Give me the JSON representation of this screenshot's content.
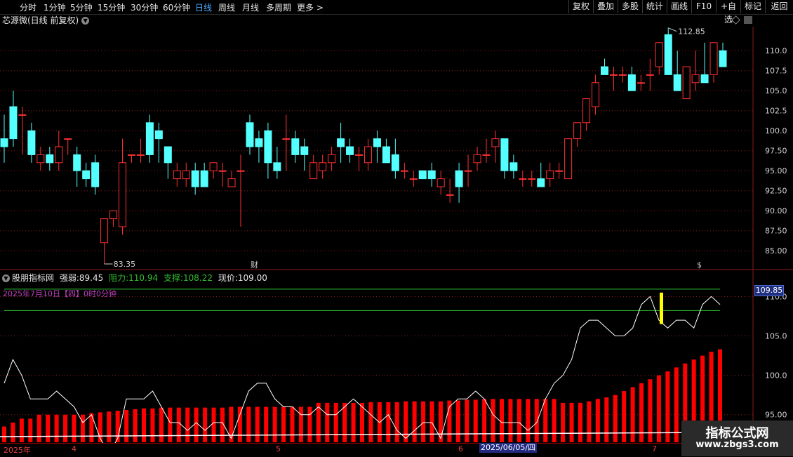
{
  "toolbar": {
    "periods": [
      "分时",
      "1分钟",
      "5分钟",
      "15分钟",
      "30分钟",
      "60分钟",
      "日线",
      "周线",
      "月线",
      "多周期",
      "更多 >"
    ],
    "active_period": "日线",
    "buttons": [
      "复权",
      "叠加",
      "多股",
      "统计",
      "画线",
      "F10",
      "+自选",
      "标记",
      "返回"
    ]
  },
  "stock": {
    "title": "芯源微(日线 前复权)"
  },
  "colors": {
    "up": "#ff3030",
    "down": "#54ffff",
    "ma": "#ffffff",
    "support": "#2fbf2f",
    "grid": "#8b1a1a"
  },
  "price_axis": [
    "110.0",
    "107.5",
    "105.0",
    "102.5",
    "100.0",
    "97.50",
    "95.00",
    "92.50",
    "90.00",
    "87.50",
    "85.00"
  ],
  "annotations": {
    "high": "112.85",
    "low": "83.35",
    "cai": "财",
    "dollar": "$"
  },
  "indicator": {
    "name": "股朋指标网",
    "strength_label": "强弱:",
    "strength": "89.45",
    "resistance_label": "阻力:",
    "resistance": "110.94",
    "support_label": "支撑:",
    "support": "108.22",
    "price_label": "现价:",
    "price": "109.00",
    "subtitle": "2025年7月10日【四】0时0分钟",
    "current_value": "109.85",
    "axis": [
      "110.0",
      "105.0",
      "100.0",
      "95.00"
    ]
  },
  "date_axis": {
    "ticks": [
      "2025年",
      "4",
      "5",
      "6",
      "7"
    ],
    "cursor_date": "2025/06/05/四"
  },
  "watermark": {
    "line1": "指标公式网",
    "line2": "www.zbgs3.com"
  },
  "chart_data": {
    "type": "candlestick",
    "ohlc": [
      [
        99,
        102,
        96,
        98
      ],
      [
        103,
        105,
        98,
        99
      ],
      [
        102,
        103,
        97,
        102
      ],
      [
        100,
        101,
        96,
        97
      ],
      [
        96,
        98,
        95,
        97
      ],
      [
        97,
        98,
        95,
        96
      ],
      [
        96,
        100,
        95,
        98
      ],
      [
        99,
        99,
        97,
        99
      ],
      [
        97,
        98,
        93,
        95
      ],
      [
        95,
        96,
        93,
        94
      ],
      [
        96,
        97,
        92,
        93
      ],
      [
        86,
        88,
        83.35,
        89
      ],
      [
        89,
        90,
        88,
        90
      ],
      [
        88,
        99,
        87,
        96
      ],
      [
        97,
        97,
        96,
        97
      ],
      [
        97,
        99,
        96,
        97
      ],
      [
        101,
        102,
        96,
        97
      ],
      [
        100,
        101,
        96,
        99
      ],
      [
        98,
        98,
        94,
        96
      ],
      [
        94,
        96,
        93,
        95
      ],
      [
        94,
        96,
        93,
        95
      ],
      [
        95,
        96,
        92,
        93
      ],
      [
        95,
        96,
        93,
        93
      ],
      [
        95,
        96,
        94,
        96
      ],
      [
        95,
        96,
        93,
        95
      ],
      [
        93,
        95,
        93,
        94
      ],
      [
        95,
        97,
        88,
        95
      ],
      [
        101,
        102,
        97,
        98
      ],
      [
        99,
        100,
        96,
        98
      ],
      [
        100,
        101,
        94,
        96
      ],
      [
        96,
        98,
        94,
        95
      ],
      [
        99,
        102,
        95,
        99
      ],
      [
        99,
        100,
        96,
        97
      ],
      [
        98,
        99,
        95,
        97
      ],
      [
        94,
        97,
        94,
        96
      ],
      [
        95,
        97,
        94,
        96
      ],
      [
        96,
        98,
        95,
        97
      ],
      [
        99,
        101,
        96,
        98
      ],
      [
        98,
        99,
        96,
        97
      ],
      [
        97,
        98,
        95,
        97
      ],
      [
        96,
        99,
        95,
        98
      ],
      [
        99,
        100,
        96,
        98
      ],
      [
        98,
        99,
        96,
        96
      ],
      [
        97,
        99,
        94,
        95
      ],
      [
        95,
        96,
        94,
        95
      ],
      [
        94,
        95,
        93,
        94
      ],
      [
        95,
        95,
        94,
        94
      ],
      [
        95,
        96,
        93,
        94
      ],
      [
        93,
        95,
        92,
        94
      ],
      [
        92,
        94,
        91,
        92
      ],
      [
        95,
        96,
        91,
        93
      ],
      [
        95,
        97,
        93,
        95
      ],
      [
        96,
        98,
        95,
        97
      ],
      [
        97,
        99,
        96,
        97
      ],
      [
        98,
        100,
        96,
        99
      ],
      [
        99,
        99,
        94,
        95
      ],
      [
        96,
        97,
        94,
        95
      ],
      [
        94,
        95,
        93,
        94
      ],
      [
        94,
        95,
        93,
        94
      ],
      [
        94,
        96,
        93,
        93
      ],
      [
        94,
        96,
        93,
        95
      ],
      [
        95,
        96,
        94,
        95
      ],
      [
        94,
        99,
        94,
        99
      ],
      [
        99,
        101,
        98,
        101
      ],
      [
        101,
        104,
        100,
        104
      ],
      [
        103,
        107,
        102,
        106
      ],
      [
        108,
        109,
        107,
        107
      ],
      [
        107,
        108,
        105,
        107
      ],
      [
        107,
        108,
        106,
        107
      ],
      [
        107,
        108,
        105,
        105
      ],
      [
        106,
        107,
        105,
        106
      ],
      [
        107,
        109,
        105,
        107
      ],
      [
        108,
        110,
        107,
        111
      ],
      [
        112,
        112.85,
        107,
        107
      ],
      [
        107,
        110,
        105,
        105
      ],
      [
        104,
        108,
        104,
        108
      ],
      [
        106,
        110,
        105,
        107
      ],
      [
        107,
        111,
        106,
        106
      ],
      [
        107,
        111,
        106,
        111
      ],
      [
        110,
        111,
        108,
        108
      ]
    ],
    "y_range": [
      83,
      113
    ],
    "indicator_bars": [
      93.5,
      94,
      94.5,
      94.5,
      95,
      95,
      95,
      95,
      95,
      95,
      95.2,
      95.3,
      95.4,
      95.5,
      95.6,
      95.7,
      95.8,
      95.8,
      95.9,
      95.9,
      95.9,
      95.9,
      95.9,
      95.9,
      95.9,
      95.9,
      96,
      96,
      96,
      96,
      96,
      96,
      96,
      96,
      96,
      96,
      96.5,
      96.5,
      96.5,
      96.5,
      96.5,
      96.5,
      96.6,
      96.6,
      96.6,
      96.6,
      96.7,
      96.7,
      96.7,
      96.7,
      96.7,
      96.8,
      96.8,
      96.9,
      96.9,
      97,
      97,
      97,
      97,
      97,
      97,
      97,
      97,
      97,
      96.5,
      96.5,
      96.5,
      96.7,
      97,
      97.2,
      97.5,
      98,
      98.5,
      99,
      99.5,
      100,
      100.5,
      101,
      101.5,
      102,
      102.5,
      103,
      103.3
    ],
    "indicator_line": [
      99,
      102,
      100,
      97,
      97,
      97,
      98,
      97,
      96,
      94,
      95,
      92,
      90,
      92,
      97,
      97,
      97,
      98,
      96,
      94,
      94,
      93,
      94,
      93,
      94,
      94,
      92,
      95,
      98,
      99,
      99,
      97,
      96,
      96,
      95,
      95,
      96,
      95,
      95,
      96,
      97,
      96,
      95,
      94,
      95,
      93,
      92,
      93,
      94,
      94,
      92,
      96,
      97,
      97,
      98,
      97,
      95,
      94,
      94,
      94,
      93,
      94,
      97,
      99,
      100,
      102,
      106,
      107,
      107,
      106,
      105,
      105,
      106,
      109,
      110,
      107,
      106,
      107,
      107,
      106,
      109,
      110,
      109
    ],
    "indicator_range": [
      91.5,
      112
    ],
    "resistance": 110.94,
    "support": 108.22
  }
}
